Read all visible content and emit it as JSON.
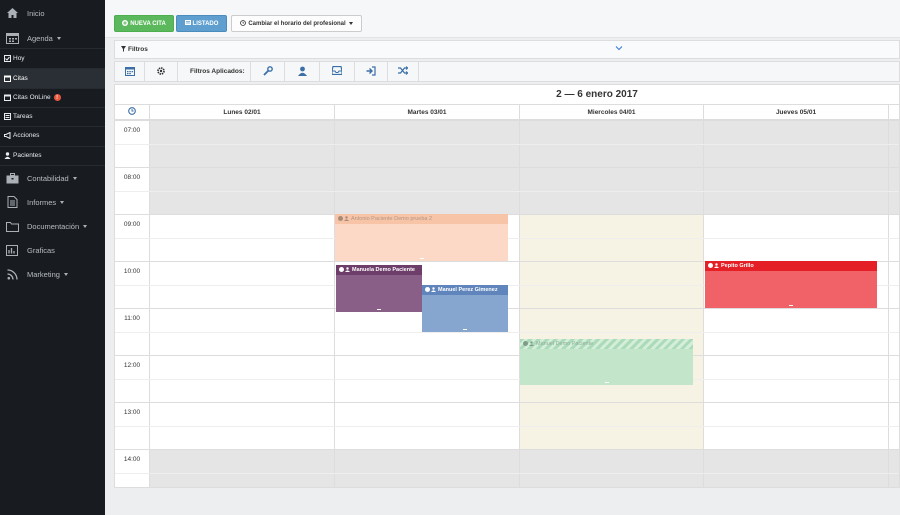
{
  "sidebar": {
    "items": [
      {
        "label": "Inicio",
        "icon": "home-icon"
      },
      {
        "label": "Agenda",
        "icon": "calendar-icon"
      },
      {
        "label": "Hoy",
        "icon": "check-square-icon"
      },
      {
        "label": "Citas",
        "icon": "calendar-small-icon"
      },
      {
        "label": "Citas OnLine",
        "icon": "calendar-online-icon",
        "badge": "!"
      },
      {
        "label": "Tareas",
        "icon": "tasks-icon"
      },
      {
        "label": "Acciones",
        "icon": "bullhorn-icon"
      },
      {
        "label": "Pacientes",
        "icon": "user-icon"
      },
      {
        "label": "Contabilidad",
        "icon": "briefcase-icon"
      },
      {
        "label": "Informes",
        "icon": "document-icon"
      },
      {
        "label": "Documentación",
        "icon": "folder-icon"
      },
      {
        "label": "Graficas",
        "icon": "bar-chart-icon"
      },
      {
        "label": "Marketing",
        "icon": "rss-icon"
      }
    ]
  },
  "topbar": {
    "new_label": "NUEVA CITA",
    "list_label": "LISTADO",
    "schedule_label": "Cambiar el horario del profesional"
  },
  "filters": {
    "title": "Filtros",
    "applied_label": "Filtros Aplicados:"
  },
  "calendar": {
    "title": "2 — 6 enero 2017",
    "days": [
      "Lunes 02/01",
      "Martes 03/01",
      "Miercoles 04/01",
      "Jueves 05/01"
    ],
    "times": [
      "07:00",
      "08:00",
      "09:00",
      "10:00",
      "11:00",
      "12:00",
      "13:00",
      "14:00"
    ],
    "events": [
      {
        "title": "Antonio Paciente Demo prueba 2",
        "color": "#f8c6ad"
      },
      {
        "title": "Manuela Demo Paciente",
        "color": "#80507d"
      },
      {
        "title": "Manuel Perez Gimenez",
        "color": "#7b9dca"
      },
      {
        "title": "Manuel Demo Paciente",
        "color": "#bfe4c8"
      },
      {
        "title": "Pepito Grillo",
        "color": "#e9262b"
      }
    ]
  },
  "colors": {
    "sidebar": "#181c21",
    "green": "#5cb85c",
    "blue": "#5e9fcf",
    "today": "#f6f3e4"
  }
}
